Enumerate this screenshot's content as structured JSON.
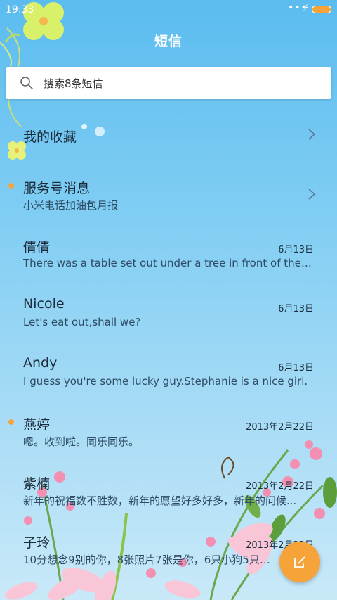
{
  "status_bar": {
    "time": "19:33",
    "signal_dots": "•••",
    "charging_icon": "⚡"
  },
  "header": {
    "title": "短信"
  },
  "search": {
    "placeholder": "搜索8条短信"
  },
  "conversations": [
    {
      "name": "我的收藏",
      "preview": "",
      "date": "",
      "unread": false,
      "has_chevron": true
    },
    {
      "name": "服务号消息",
      "preview": "小米电话加油包月报",
      "date": "",
      "unread": true,
      "has_chevron": true
    },
    {
      "name": "倩倩",
      "preview": "There was a table set out under a tree in front of the ho...",
      "date": "6月13日",
      "unread": false
    },
    {
      "name": "Nicole",
      "preview": "Let's eat out,shall we?",
      "date": "6月13日",
      "unread": false
    },
    {
      "name": "Andy",
      "preview": "I guess you're some lucky guy.Stephanie is a nice girl.",
      "date": "6月13日",
      "unread": false
    },
    {
      "name": "燕婷",
      "preview": "嗯。收到啦。同乐同乐。",
      "date": "2013年2月22日",
      "unread": true
    },
    {
      "name": "紫楠",
      "preview": "新年的祝福数不胜数，新年的愿望好多好多，新年的问候...",
      "date": "2013年2月22日",
      "unread": false
    },
    {
      "name": "子玲",
      "preview": "10分想念9别的你，8张照片7张是你，6只小狗5只像你...",
      "date": "2013年2月22日",
      "unread": false
    }
  ],
  "fab": {
    "icon": "compose-icon"
  },
  "colors": {
    "accent": "#f6a33a",
    "background_top": "#5bbcef",
    "background_bottom": "#c9e9f8"
  }
}
